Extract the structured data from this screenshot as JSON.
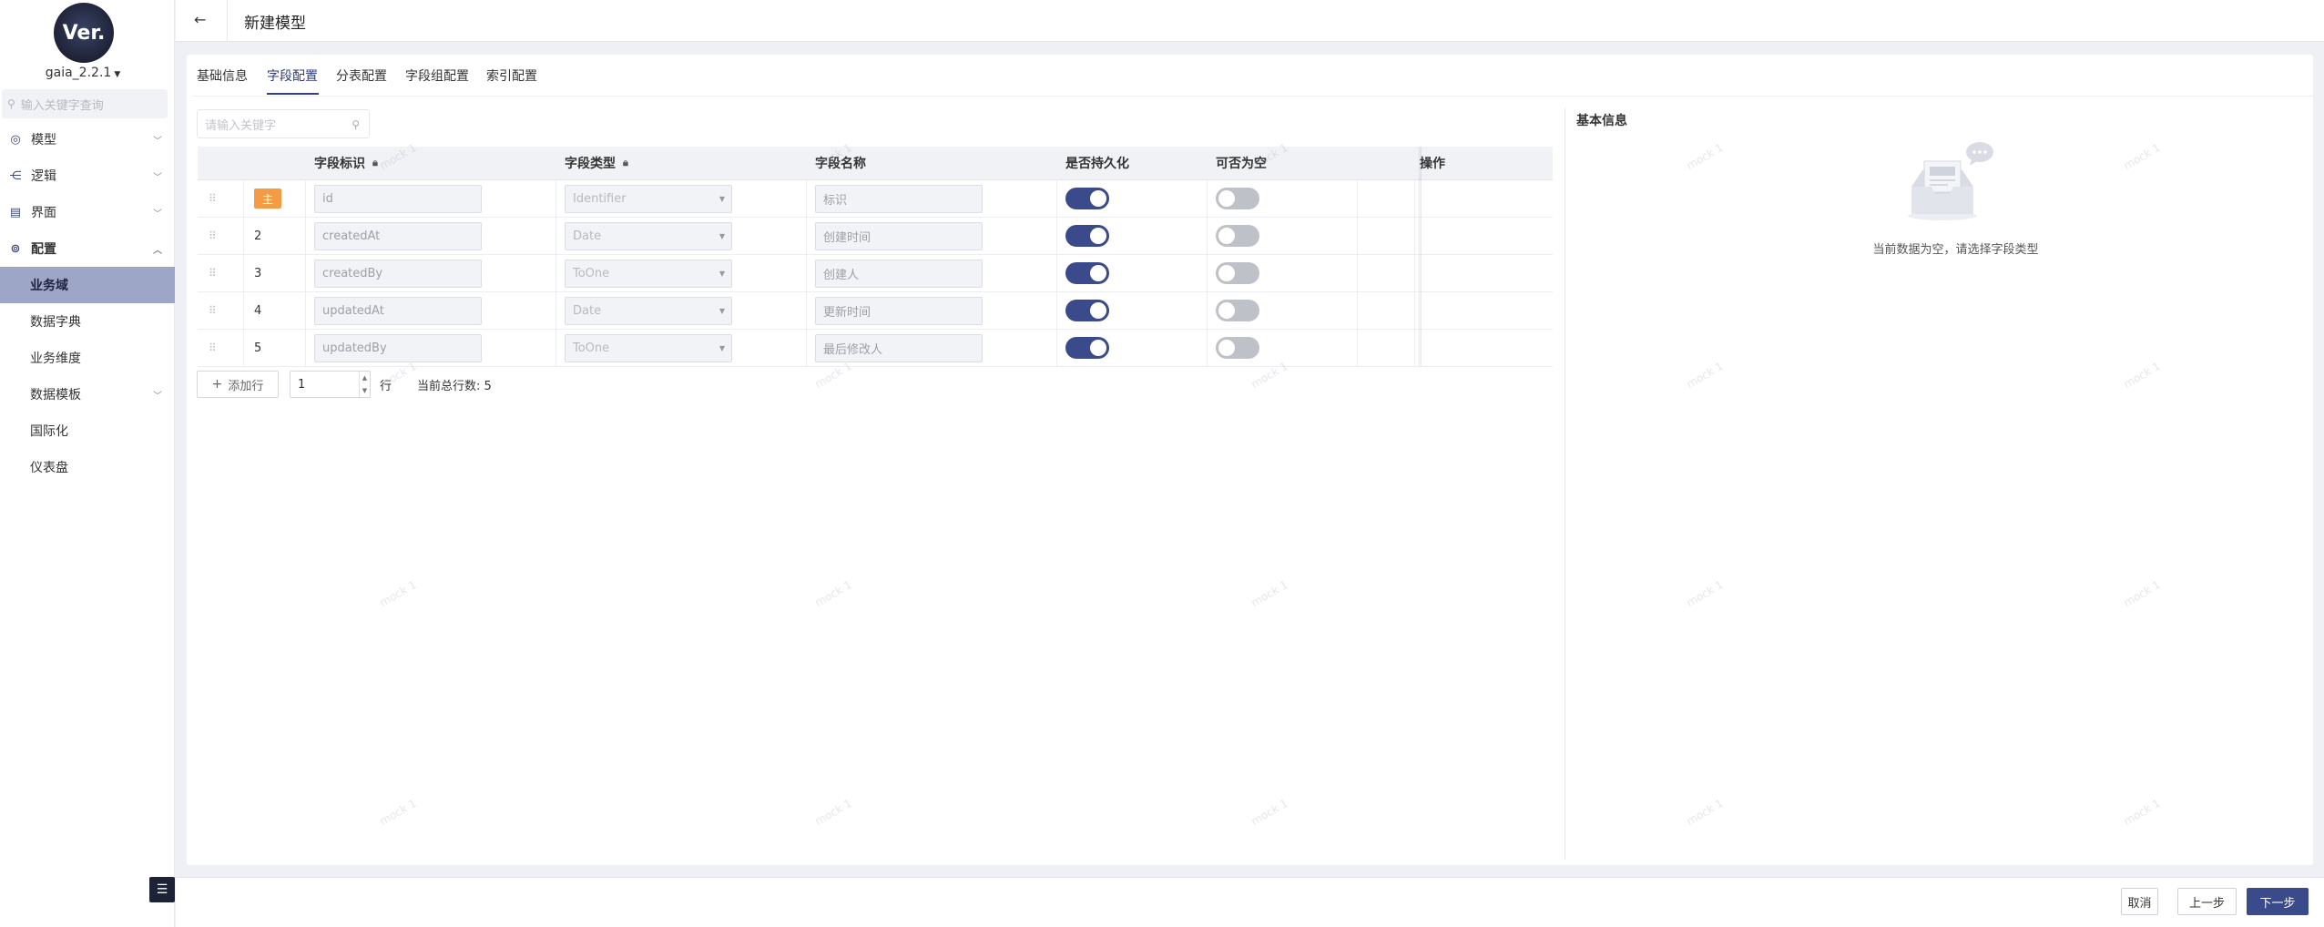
{
  "logo": {
    "text": "Ver."
  },
  "version": {
    "label": "gaia_2.2.1"
  },
  "sidebar": {
    "search_placeholder": "输入关键字查询",
    "items": [
      {
        "label": "模型",
        "icon": "model-icon"
      },
      {
        "label": "逻辑",
        "icon": "logic-icon"
      },
      {
        "label": "界面",
        "icon": "interface-icon"
      },
      {
        "label": "配置",
        "icon": "config-icon"
      }
    ],
    "sub_items": [
      {
        "label": "业务域"
      },
      {
        "label": "数据字典"
      },
      {
        "label": "业务维度"
      },
      {
        "label": "数据模板"
      },
      {
        "label": "国际化"
      },
      {
        "label": "仪表盘"
      }
    ]
  },
  "header": {
    "back": "←",
    "title": "新建模型"
  },
  "tabs": [
    {
      "label": "基础信息"
    },
    {
      "label": "字段配置"
    },
    {
      "label": "分表配置"
    },
    {
      "label": "字段组配置"
    },
    {
      "label": "索引配置"
    }
  ],
  "table": {
    "search_placeholder": "请输入关键字",
    "columns": {
      "field_id": "字段标识",
      "field_type": "字段类型",
      "field_name": "字段名称",
      "persist": "是否持久化",
      "nullable": "可否为空",
      "action": "操作"
    },
    "primary_badge": "主",
    "rows": [
      {
        "index": "",
        "id": "id",
        "type": "Identifier",
        "name": "标识",
        "persist": true,
        "nullable": false
      },
      {
        "index": "2",
        "id": "createdAt",
        "type": "Date",
        "name": "创建时间",
        "persist": true,
        "nullable": false
      },
      {
        "index": "3",
        "id": "createdBy",
        "type": "ToOne",
        "name": "创建人",
        "persist": true,
        "nullable": false
      },
      {
        "index": "4",
        "id": "updatedAt",
        "type": "Date",
        "name": "更新时间",
        "persist": true,
        "nullable": false
      },
      {
        "index": "5",
        "id": "updatedBy",
        "type": "ToOne",
        "name": "最后修改人",
        "persist": true,
        "nullable": false
      }
    ],
    "add_row_label": "添加行",
    "add_row_count": "1",
    "row_unit": "行",
    "total_label": "当前总行数:",
    "total_value": "5"
  },
  "panel": {
    "title": "基本信息",
    "empty_text": "当前数据为空，请选择字段类型"
  },
  "footer": {
    "cancel": "取消",
    "prev": "上一步",
    "next": "下一步"
  },
  "watermark": "mock 1",
  "colors": {
    "primary": "#3b4a8a",
    "badge": "#f39b45",
    "active_nav": "#9da6c7"
  }
}
